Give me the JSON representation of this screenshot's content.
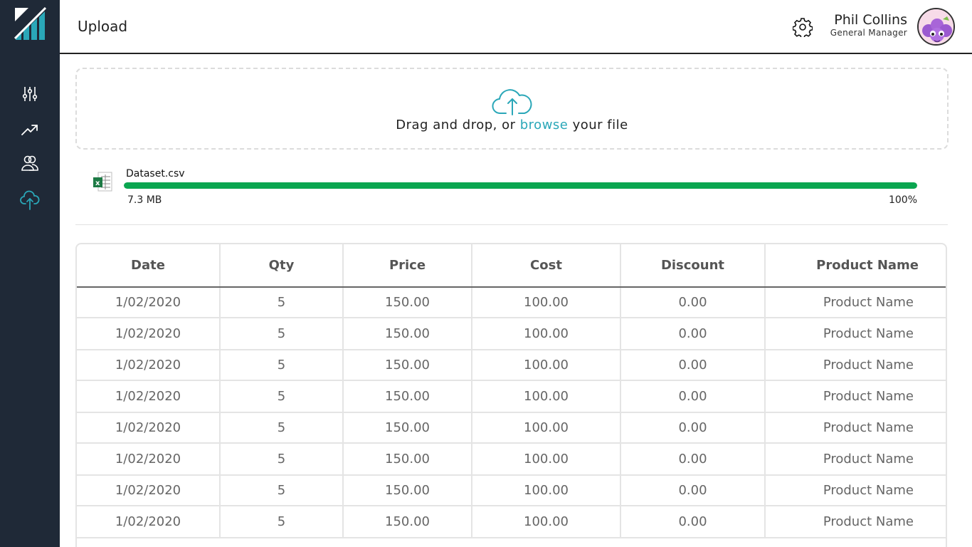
{
  "header": {
    "title": "Upload",
    "user_name": "Phil Collins",
    "user_role": "General Manager"
  },
  "sidebar": {
    "items": [
      {
        "name": "filters",
        "icon": "sliders-icon",
        "active": false
      },
      {
        "name": "analytics",
        "icon": "trending-up-icon",
        "active": false
      },
      {
        "name": "users",
        "icon": "users-icon",
        "active": false
      },
      {
        "name": "upload",
        "icon": "cloud-upload-icon",
        "active": true
      }
    ]
  },
  "dropzone": {
    "text_before": "Drag and drop, or ",
    "link": "browse",
    "text_after": " your file"
  },
  "file": {
    "name": "Dataset.csv",
    "size": "7.3 MB",
    "progress_label": "100%",
    "progress": 1.0
  },
  "table": {
    "columns": [
      "Date",
      "Qty",
      "Price",
      "Cost",
      "Discount",
      "Product Name"
    ],
    "rows": [
      [
        "1/02/2020",
        "5",
        "150.00",
        "100.00",
        "0.00",
        "Product Name"
      ],
      [
        "1/02/2020",
        "5",
        "150.00",
        "100.00",
        "0.00",
        "Product Name"
      ],
      [
        "1/02/2020",
        "5",
        "150.00",
        "100.00",
        "0.00",
        "Product Name"
      ],
      [
        "1/02/2020",
        "5",
        "150.00",
        "100.00",
        "0.00",
        "Product Name"
      ],
      [
        "1/02/2020",
        "5",
        "150.00",
        "100.00",
        "0.00",
        "Product Name"
      ],
      [
        "1/02/2020",
        "5",
        "150.00",
        "100.00",
        "0.00",
        "Product Name"
      ],
      [
        "1/02/2020",
        "5",
        "150.00",
        "100.00",
        "0.00",
        "Product Name"
      ],
      [
        "1/02/2020",
        "5",
        "150.00",
        "100.00",
        "0.00",
        "Product Name"
      ]
    ]
  },
  "colors": {
    "sidebar_bg": "#1f2937",
    "accent": "#2aa7b8",
    "progress": "#0aa650"
  }
}
